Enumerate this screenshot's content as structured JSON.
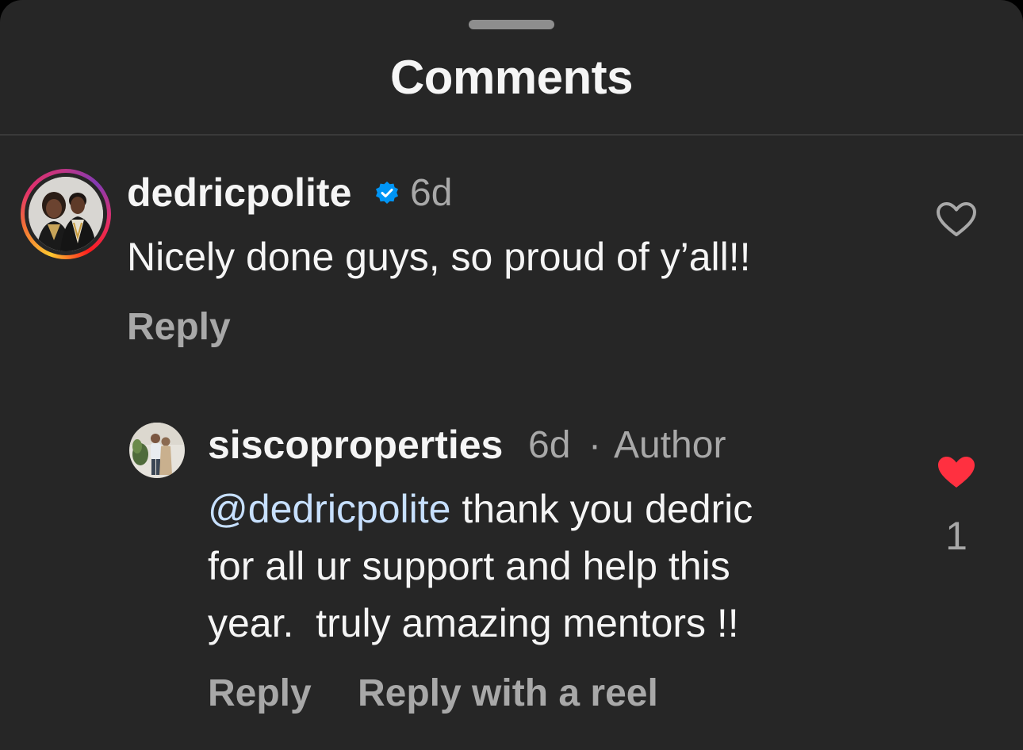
{
  "header": {
    "title": "Comments"
  },
  "comments": [
    {
      "username": "dedricpolite",
      "verified": true,
      "age": "6d",
      "text": "Nicely done guys, so proud of y’all!!",
      "actions": {
        "reply": "Reply"
      },
      "liked": false
    }
  ],
  "replies": [
    {
      "username": "siscoproperties",
      "age": "6d",
      "separator": "·",
      "badge": "Author",
      "mention": "@dedricpolite",
      "text_line1": " thank you dedric",
      "text_line2": "for all ur support and help this",
      "text_line3": "year.  truly amazing mentors !!",
      "actions": {
        "reply": "Reply",
        "reply_reel": "Reply with a reel"
      },
      "liked": true,
      "like_count": "1"
    }
  ],
  "colors": {
    "background": "#262626",
    "text": "#f5f5f5",
    "secondary": "#a8a8a8",
    "mention": "#c7e0ff",
    "verified": "#0095f6",
    "like": "#ff3040"
  },
  "icons": {
    "verified": "verified-badge-icon",
    "like_empty": "heart-outline-icon",
    "like_filled": "heart-filled-icon"
  }
}
